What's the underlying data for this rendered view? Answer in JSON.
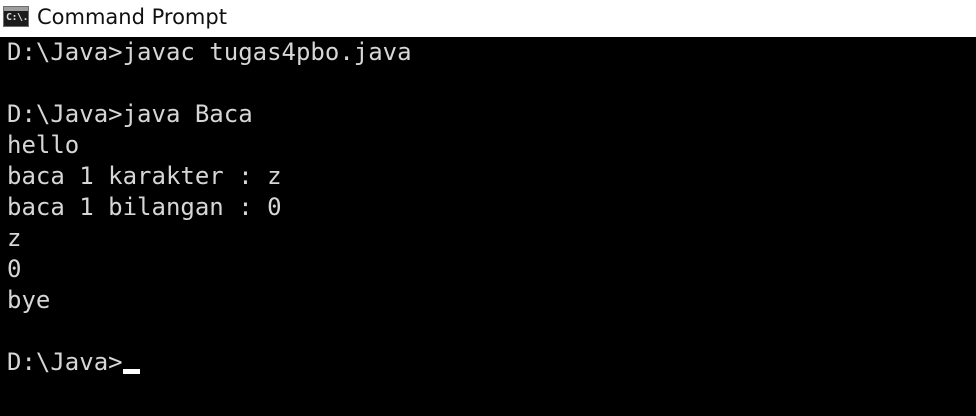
{
  "window": {
    "title": "Command Prompt",
    "icon": "console-app-icon",
    "icon_glyph": "C:\\."
  },
  "console": {
    "lines": [
      "D:\\Java>javac tugas4pbo.java",
      "",
      "D:\\Java>java Baca",
      "hello",
      "baca 1 karakter : z",
      "baca 1 bilangan : 0",
      "z",
      "0",
      "bye",
      "",
      "D:\\Java>"
    ],
    "current_prompt": "D:\\Java>",
    "colors": {
      "background": "#000000",
      "foreground": "#d6d6d6",
      "cursor": "#ffffff"
    }
  }
}
